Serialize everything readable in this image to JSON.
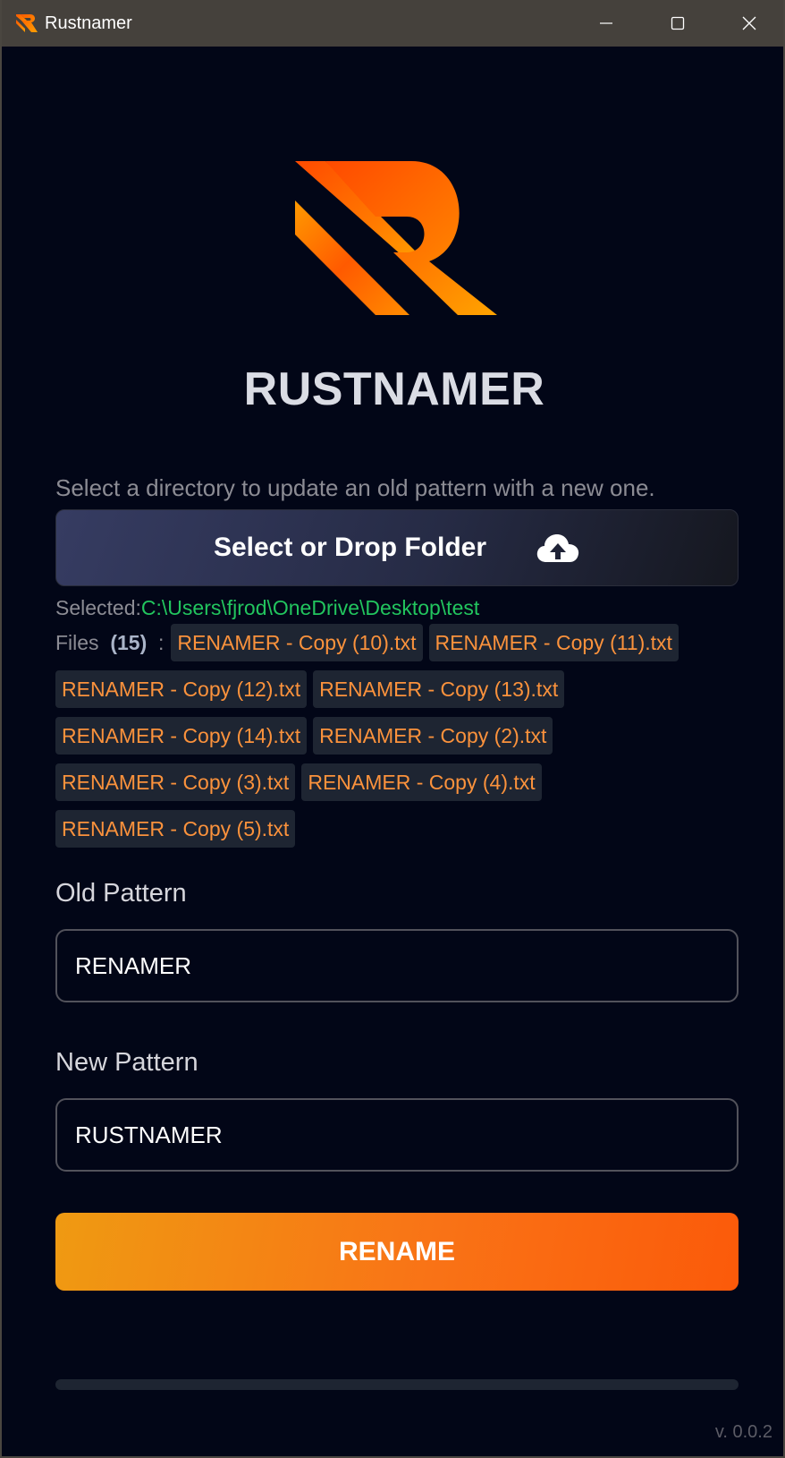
{
  "window": {
    "title": "Rustnamer"
  },
  "header": {
    "app_name": "RUSTNAMER",
    "instruction": "Select a directory to update an old pattern with a new one."
  },
  "select_button": {
    "label": "Select or Drop Folder",
    "icon": "cloud-upload-icon"
  },
  "selection": {
    "label": "Selected:",
    "path": "C:\\Users\\fjrod\\OneDrive\\Desktop\\test"
  },
  "files": {
    "label": "Files",
    "count": "(15)",
    "separator": ":",
    "items": [
      "RENAMER - Copy (10).txt",
      "RENAMER - Copy (11).txt",
      "RENAMER - Copy (12).txt",
      "RENAMER - Copy (13).txt",
      "RENAMER - Copy (14).txt",
      "RENAMER - Copy (2).txt",
      "RENAMER - Copy (3).txt",
      "RENAMER - Copy (4).txt",
      "RENAMER - Copy (5).txt"
    ]
  },
  "old_pattern": {
    "label": "Old Pattern",
    "value": "RENAMER"
  },
  "new_pattern": {
    "label": "New Pattern",
    "value": "RUSTNAMER"
  },
  "rename_button": {
    "label": "RENAME"
  },
  "progress": {
    "value_percent": 0
  },
  "footer": {
    "version": "v. 0.0.2"
  },
  "colors": {
    "background": "#020617",
    "accent": "#f97316",
    "path": "#22c55e",
    "chip_text": "#fb923c",
    "chip_bg": "#1e2532"
  }
}
